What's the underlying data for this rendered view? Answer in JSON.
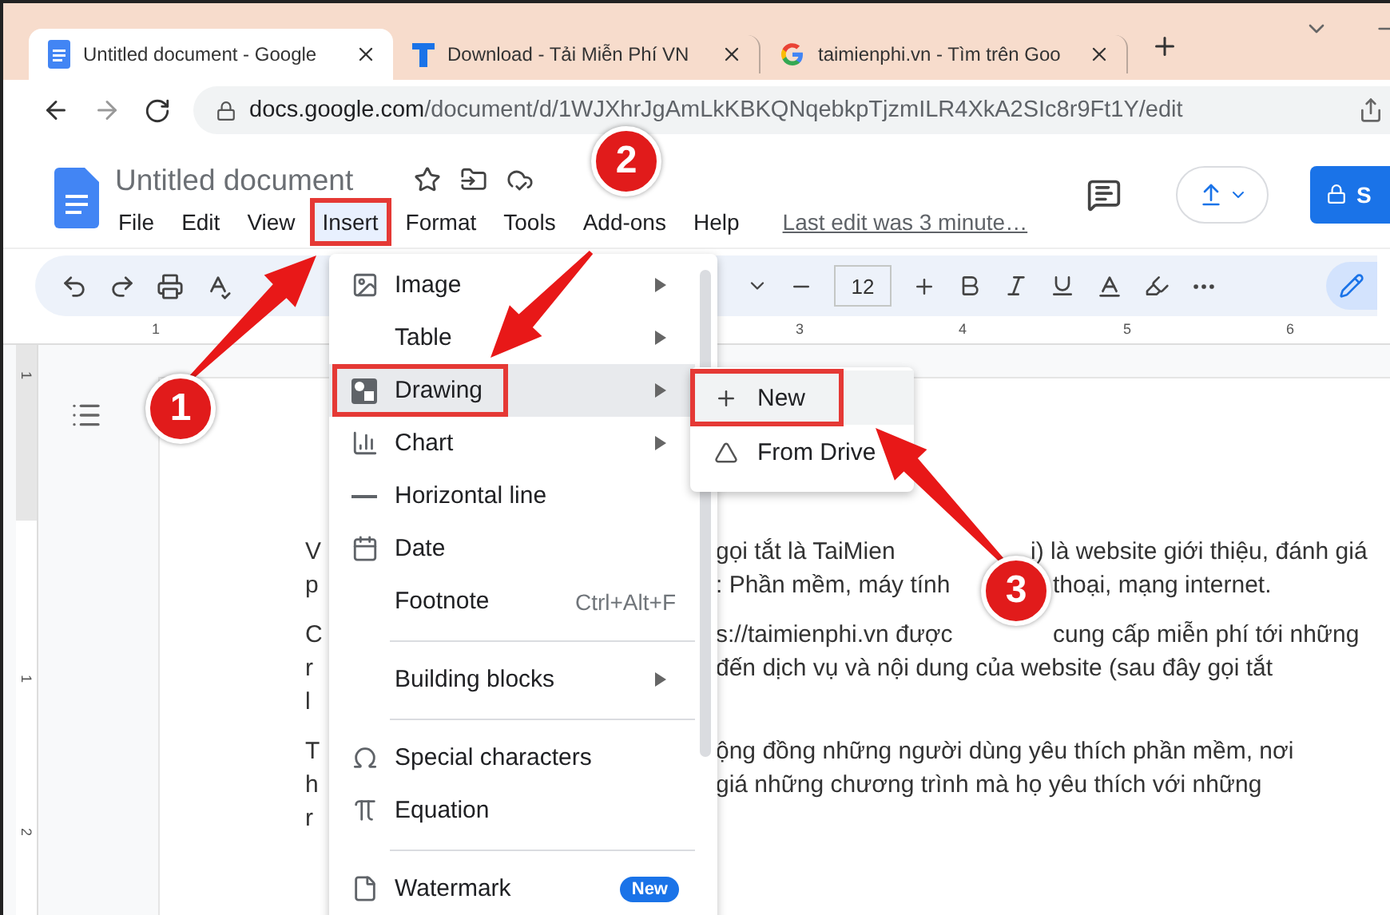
{
  "browser": {
    "tabs": [
      {
        "title": "Untitled document - Google",
        "selected": true
      },
      {
        "title": "Download - Tải Miễn Phí VN",
        "selected": false
      },
      {
        "title": "taimienphi.vn - Tìm trên Goo",
        "selected": false
      }
    ],
    "url_host": "docs.google.com",
    "url_path": "/document/d/1WJXhrJgAmLkKBKQNqebkpTjzmILR4XkA2SIc8r9Ft1Y/edit"
  },
  "docs": {
    "title": "Untitled document",
    "menus": [
      {
        "label": "File",
        "selected": false,
        "highlighted": false
      },
      {
        "label": "Edit",
        "selected": false,
        "highlighted": false
      },
      {
        "label": "View",
        "selected": false,
        "highlighted": false
      },
      {
        "label": "Insert",
        "selected": true,
        "highlighted": true
      },
      {
        "label": "Format",
        "selected": false,
        "highlighted": false
      },
      {
        "label": "Tools",
        "selected": false,
        "highlighted": false
      },
      {
        "label": "Add-ons",
        "selected": false,
        "highlighted": false
      },
      {
        "label": "Help",
        "selected": false,
        "highlighted": false
      }
    ],
    "last_edit": "Last edit was 3 minute…",
    "share_label": "S"
  },
  "toolbar": {
    "font_size": "12"
  },
  "ruler": [
    "1",
    "3",
    "4",
    "5",
    "6"
  ],
  "vertical_ruler": [
    "1",
    "1",
    "2"
  ],
  "document": {
    "paragraphs": [
      {
        "lines": [
          {
            "left": "V",
            "right": [
              "gọi tắt là TaiMien",
              "i) là website giới thiệu, đánh giá"
            ]
          },
          {
            "left": "p",
            "right": [
              ": Phần mềm, máy tính",
              "thoại, mạng internet."
            ]
          }
        ]
      },
      {
        "lines": [
          {
            "left": "C",
            "right": [
              "s://taimienphi.vn được",
              "cung cấp miễn phí tới những"
            ]
          },
          {
            "left": "r",
            "right": [
              "đến dịch vụ và nội dung của website (sau đây gọi tắt"
            ]
          },
          {
            "left": "l"
          }
        ]
      },
      {
        "lines": [
          {
            "left": "T",
            "right": [
              "ộng đồng những người dùng yêu thích phần mềm, nơi"
            ]
          },
          {
            "left": "h",
            "right": [
              "giá những chương trình mà họ yêu thích với những"
            ]
          },
          {
            "left": "r"
          }
        ]
      }
    ]
  },
  "insert_menu": {
    "items": [
      {
        "kind": "item",
        "label": "Image",
        "submenu": true,
        "selected": false,
        "highlighted": false
      },
      {
        "kind": "item",
        "label": "Table",
        "submenu": true,
        "selected": false,
        "highlighted": false
      },
      {
        "kind": "item",
        "label": "Drawing",
        "submenu": true,
        "selected": true,
        "highlighted": true
      },
      {
        "kind": "item",
        "label": "Chart",
        "submenu": true,
        "selected": false,
        "highlighted": false
      },
      {
        "kind": "item",
        "label": "Horizontal line",
        "submenu": false,
        "selected": false,
        "highlighted": false
      },
      {
        "kind": "item",
        "label": "Date",
        "submenu": false,
        "selected": false,
        "highlighted": false
      },
      {
        "kind": "item",
        "label": "Footnote",
        "shortcut": "Ctrl+Alt+F",
        "submenu": false,
        "selected": false,
        "highlighted": false
      },
      {
        "kind": "separator"
      },
      {
        "kind": "item",
        "label": "Building blocks",
        "submenu": true,
        "selected": false,
        "highlighted": false
      },
      {
        "kind": "separator"
      },
      {
        "kind": "item",
        "label": "Special characters",
        "submenu": false,
        "selected": false,
        "highlighted": false
      },
      {
        "kind": "item",
        "label": "Equation",
        "submenu": false,
        "selected": false,
        "highlighted": false
      },
      {
        "kind": "separator"
      },
      {
        "kind": "item",
        "label": "Watermark",
        "badge": "New",
        "submenu": false,
        "selected": false,
        "highlighted": false
      }
    ]
  },
  "drawing_submenu": {
    "items": [
      {
        "label": "New",
        "selected": true,
        "highlighted": true
      },
      {
        "label": "From Drive",
        "selected": false,
        "highlighted": false
      }
    ]
  },
  "annotations": [
    {
      "number": "1"
    },
    {
      "number": "2"
    },
    {
      "number": "3"
    }
  ]
}
